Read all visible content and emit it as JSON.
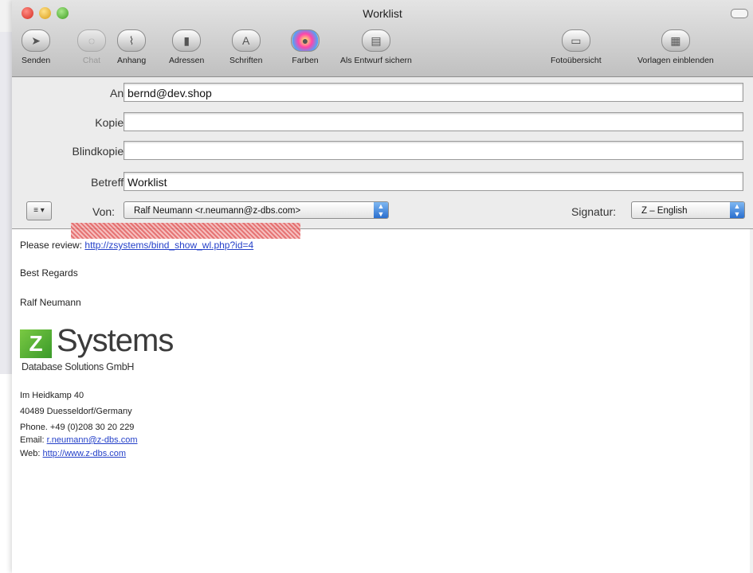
{
  "window": {
    "title": "Worklist"
  },
  "toolbar": {
    "items": [
      {
        "label": "Senden",
        "icon": "send-icon"
      },
      {
        "label": "Chat",
        "icon": "chat-icon"
      },
      {
        "label": "Anhang",
        "icon": "attachment-icon"
      },
      {
        "label": "Adressen",
        "icon": "address-book-icon"
      },
      {
        "label": "Schriften",
        "icon": "fonts-icon"
      },
      {
        "label": "Farben",
        "icon": "colors-icon"
      },
      {
        "label": "Als Entwurf sichern",
        "icon": "save-draft-icon"
      },
      {
        "label": "Fotoübersicht",
        "icon": "photo-browser-icon"
      },
      {
        "label": "Vorlagen einblenden",
        "icon": "stationery-icon"
      }
    ]
  },
  "headers": {
    "to_label": "An:",
    "to_value": "bernd@dev.shop",
    "cc_label": "Kopie:",
    "cc_value": "",
    "bcc_label": "Blindkopie:",
    "bcc_value": "",
    "subject_label": "Betreff:",
    "subject_value": "Worklist",
    "account_button": "≡ ▾",
    "from_label": "Von:",
    "from_value": "Ralf Neumann <r.neumann@z-dbs.com>",
    "signature_label": "Signatur:",
    "signature_value": "Z – English"
  },
  "body": {
    "review_prefix": "Please review:",
    "review_link": "http://zsystems/bind_show_wl.php?id=4",
    "regards": "Best Regards",
    "name": "Ralf Neumann",
    "logo_letter": "Z",
    "logo_word": "Systems",
    "logo_sub": "Database Solutions GmbH",
    "street": "Im Heidkamp 40",
    "city": "40489 Duesseldorf/Germany",
    "phone": "Phone. +49 (0)208 30 20 229",
    "email_prefix": "Email:",
    "email_link": "r.neumann@z-dbs.com",
    "web_prefix": "Web:",
    "web_link": "http://www.z-dbs.com"
  }
}
